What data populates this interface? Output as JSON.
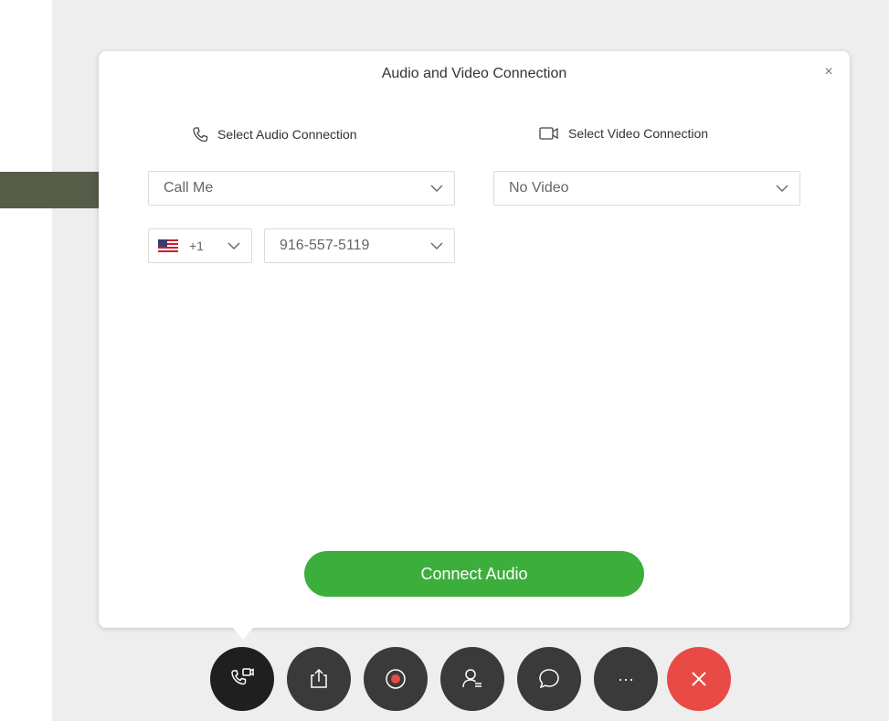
{
  "dialog": {
    "title": "Audio and Video Connection",
    "close_symbol": "×"
  },
  "audio": {
    "section_label": "Select Audio Connection",
    "section_icon": "phone-icon",
    "connection_value": "Call Me",
    "country_code": "+1",
    "country_flag": "us-flag-icon",
    "phone_number": "916-557-5119"
  },
  "video": {
    "section_label": "Select Video Connection",
    "section_icon": "video-camera-icon",
    "connection_value": "No Video"
  },
  "actions": {
    "connect_label": "Connect Audio"
  },
  "toolbar": {
    "buttons": [
      "audio-video-icon",
      "share-icon",
      "record-icon",
      "participants-icon",
      "chat-icon",
      "more-icon",
      "end-meeting-icon"
    ],
    "more_symbol": "···"
  },
  "colors": {
    "accent_green": "#3cae3c",
    "end_red": "#e84a45",
    "toolbar_dark": "#3a3a3a",
    "annotation_arrow": "#565c48"
  }
}
